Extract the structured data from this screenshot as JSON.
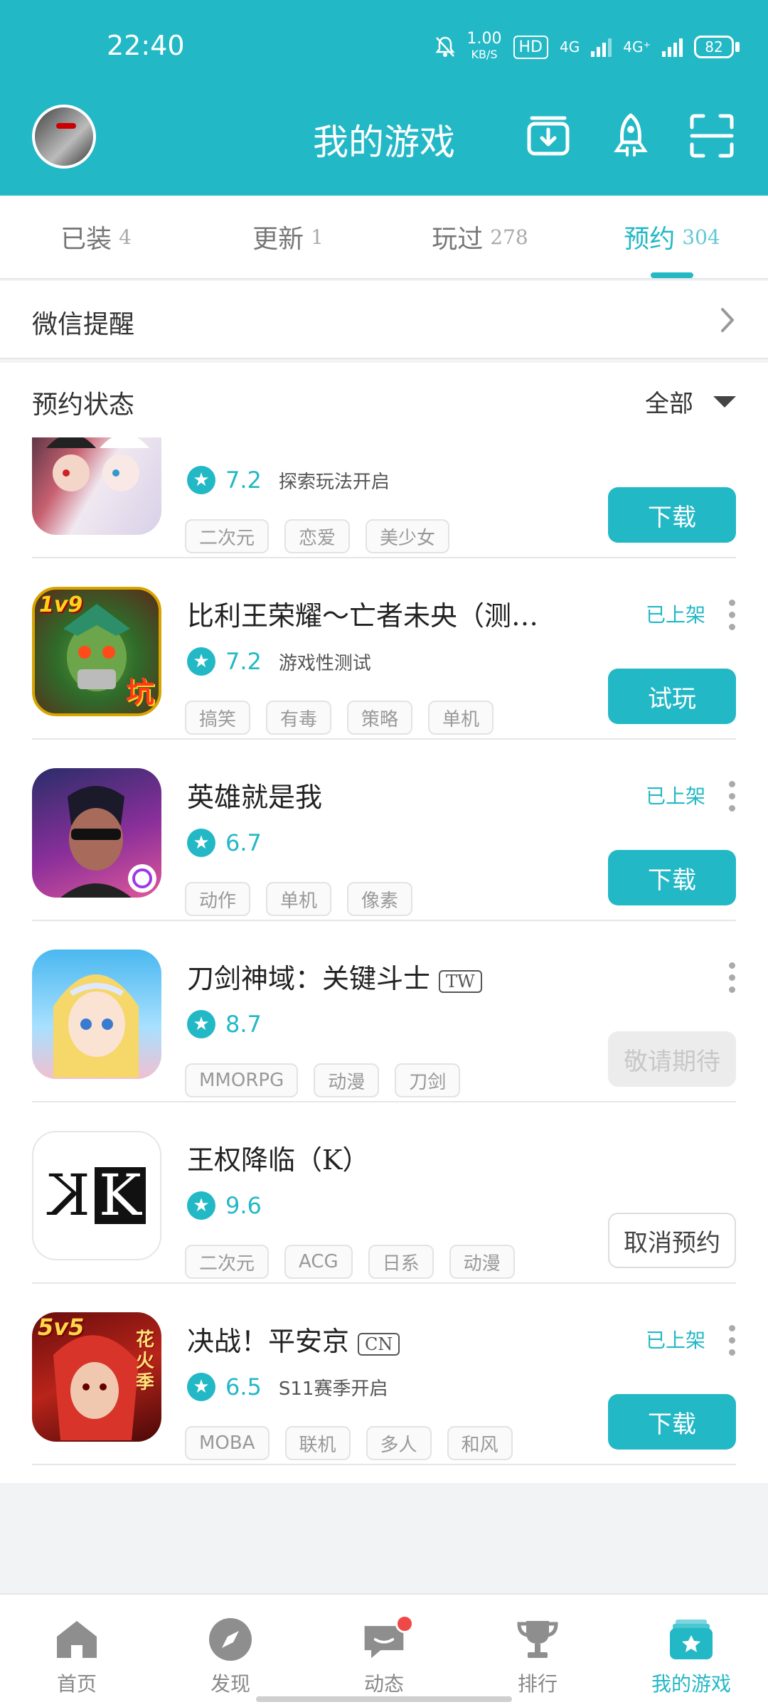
{
  "status": {
    "time": "22:40",
    "net_speed": "1.00",
    "net_unit": "KB/S",
    "hd": "HD",
    "net1": "4G",
    "net2": "4G⁺",
    "battery": "82"
  },
  "header": {
    "title": "我的游戏",
    "color": "#23b8c6",
    "icons": [
      "download-box-icon",
      "rocket-icon",
      "scan-icon"
    ]
  },
  "tabs": [
    {
      "label": "已装",
      "count": "4"
    },
    {
      "label": "更新",
      "count": "1"
    },
    {
      "label": "玩过",
      "count": "278"
    },
    {
      "label": "预约",
      "count": "304"
    }
  ],
  "wechat_row": {
    "label": "微信提醒"
  },
  "status_row": {
    "label": "预约状态",
    "filter": "全部"
  },
  "games": [
    {
      "name": "",
      "region": "",
      "score": "7.2",
      "note": "探索玩法开启",
      "tags": [
        "二次元",
        "恋爱",
        "美少女"
      ],
      "listed": "",
      "button": "下载"
    },
    {
      "name": "比利王荣耀～亡者未央（测…",
      "region": "",
      "score": "7.2",
      "note": "游戏性测试",
      "tags": [
        "搞笑",
        "有毒",
        "策略",
        "单机"
      ],
      "listed": "已上架",
      "button": "试玩"
    },
    {
      "name": "英雄就是我",
      "region": "",
      "score": "6.7",
      "note": "",
      "tags": [
        "动作",
        "单机",
        "像素"
      ],
      "listed": "已上架",
      "button": "下载"
    },
    {
      "name": "刀剑神域：关键斗士",
      "region": "TW",
      "score": "8.7",
      "note": "",
      "tags": [
        "MMORPG",
        "动漫",
        "刀剑"
      ],
      "listed": "",
      "button": "敬请期待"
    },
    {
      "name": "王权降临（K）",
      "region": "",
      "score": "9.6",
      "note": "",
      "tags": [
        "二次元",
        "ACG",
        "日系",
        "动漫"
      ],
      "listed": "",
      "button": "取消预约"
    },
    {
      "name": "决战！平安京",
      "region": "CN",
      "score": "6.5",
      "note": "S11赛季开启",
      "tags": [
        "MOBA",
        "联机",
        "多人",
        "和风"
      ],
      "listed": "已上架",
      "button": "下载"
    }
  ],
  "icon_texts": {
    "billy": [
      "1v9",
      "坑"
    ],
    "k_logo": "K",
    "onmyoji": [
      "5v5",
      "花火季"
    ]
  },
  "bottom_nav": [
    {
      "label": "首页",
      "icon": "home-icon"
    },
    {
      "label": "发现",
      "icon": "compass-icon"
    },
    {
      "label": "动态",
      "icon": "chat-icon"
    },
    {
      "label": "排行",
      "icon": "trophy-icon"
    },
    {
      "label": "我的游戏",
      "icon": "my-games-icon"
    }
  ]
}
